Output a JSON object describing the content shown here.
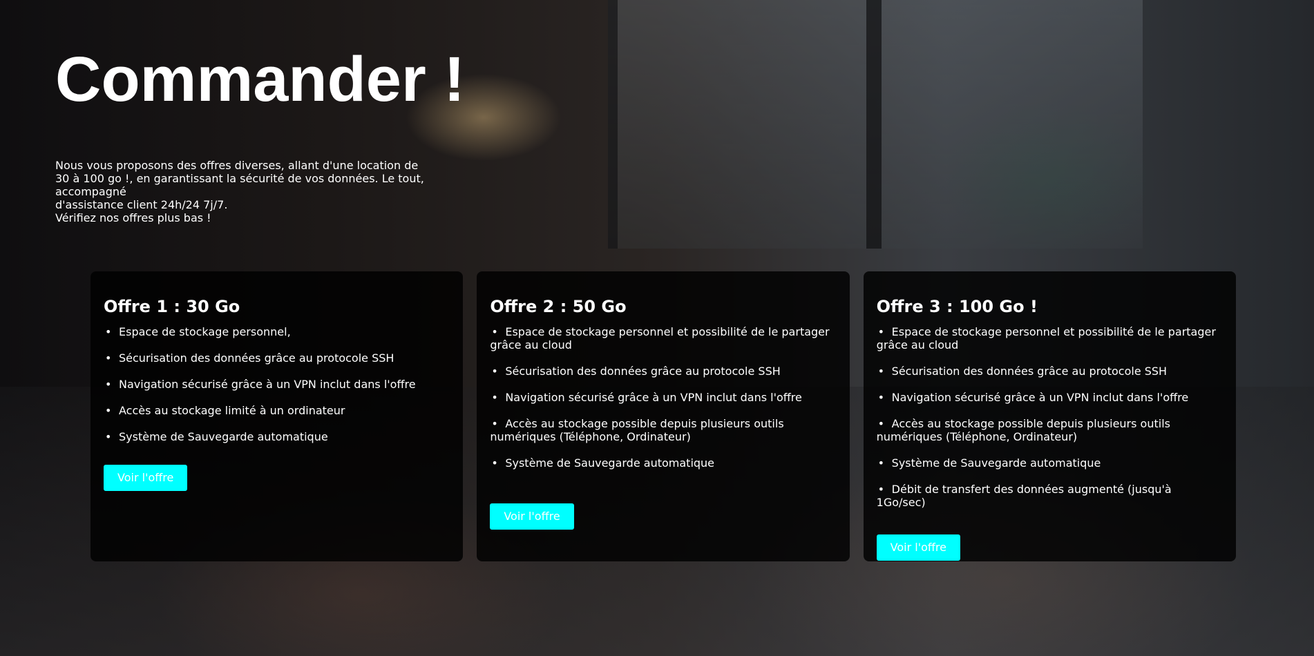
{
  "page": {
    "title": "Commander !",
    "intro_lines": [
      "Nous vous proposons des offres diverses, allant d'une location de",
      "30 à 100 go !, en garantissant la sécurité de vos données. Le tout, accompagné",
      "d'assistance client 24h/24 7j/7.",
      "Vérifiez nos offres plus bas !"
    ]
  },
  "offers": [
    {
      "title": "Offre 1 : 30 Go",
      "features": [
        "Espace de stockage personnel,",
        "Sécurisation des données grâce au protocole SSH",
        "Navigation sécurisé grâce à un VPN inclut dans l'offre",
        "Accès au stockage limité à un ordinateur",
        "Système de Sauvegarde automatique"
      ],
      "button_label": "Voir l'offre"
    },
    {
      "title": "Offre 2 : 50 Go",
      "features": [
        "Espace de stockage personnel et possibilité de le partager grâce au cloud",
        "Sécurisation des données grâce au protocole SSH",
        "Navigation sécurisé grâce à un VPN inclut dans l'offre",
        "Accès au stockage possible depuis plusieurs outils numériques (Téléphone, Ordinateur)",
        "Système de Sauvegarde automatique"
      ],
      "button_label": "Voir l'offre"
    },
    {
      "title": "Offre 3 : 100 Go !",
      "features": [
        "Espace de stockage personnel et possibilité de le partager grâce au cloud",
        "Sécurisation des données grâce au protocole SSH",
        "Navigation sécurisé grâce à un VPN inclut dans l'offre",
        "Accès au stockage possible depuis plusieurs outils numériques (Téléphone, Ordinateur)",
        "Système de Sauvegarde automatique",
        "Débit de transfert des données augmenté (jusqu'à 1Go/sec)"
      ],
      "button_label": "Voir l'offre"
    }
  ],
  "colors": {
    "accent": "#00ffff",
    "card_background": "#000000",
    "text": "#ffffff"
  },
  "icons": {
    "list_bullet": "bullet-icon"
  }
}
